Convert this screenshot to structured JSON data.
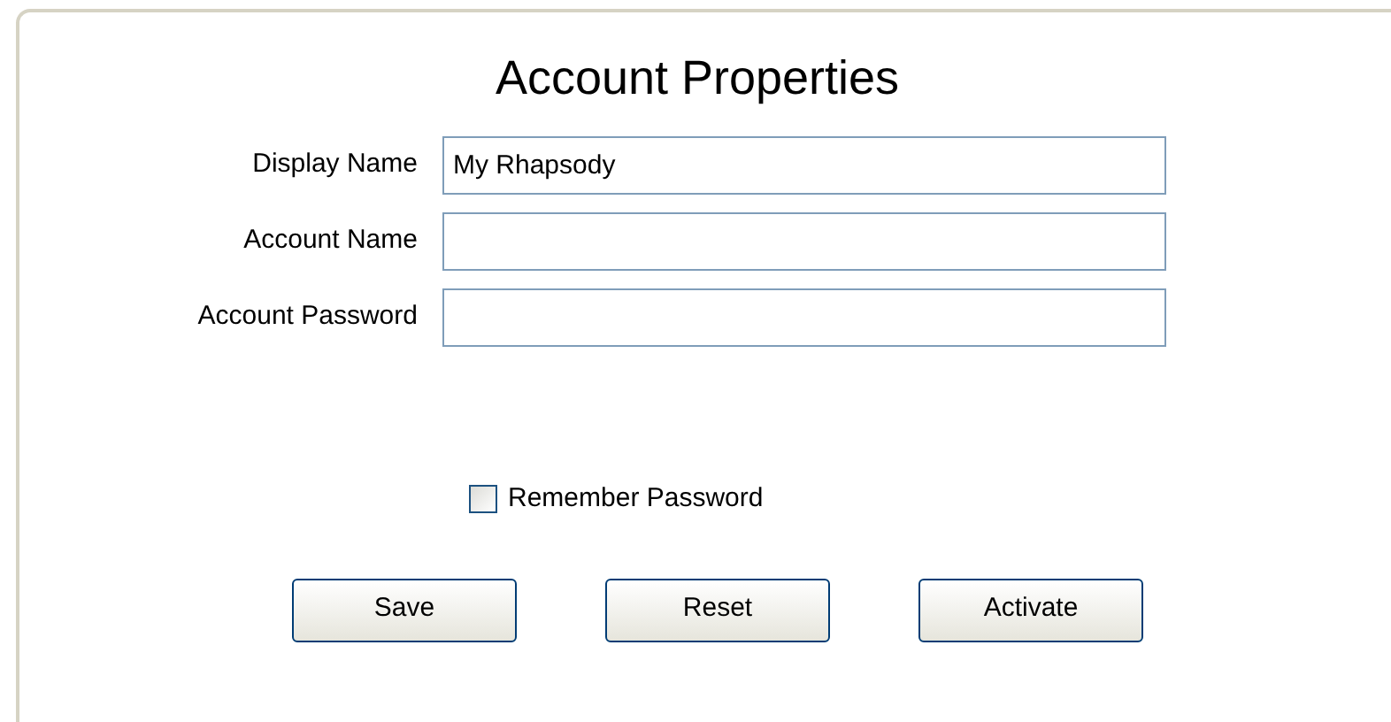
{
  "title": "Account Properties",
  "fields": [
    {
      "label": "Display Name",
      "value": "My Rhapsody"
    },
    {
      "label": "Account Name"
    },
    {
      "label": "Account Password"
    }
  ],
  "remember_password": {
    "label": "Remember Password",
    "checked": false
  },
  "buttons": [
    "Save",
    "Reset",
    "Activate"
  ]
}
